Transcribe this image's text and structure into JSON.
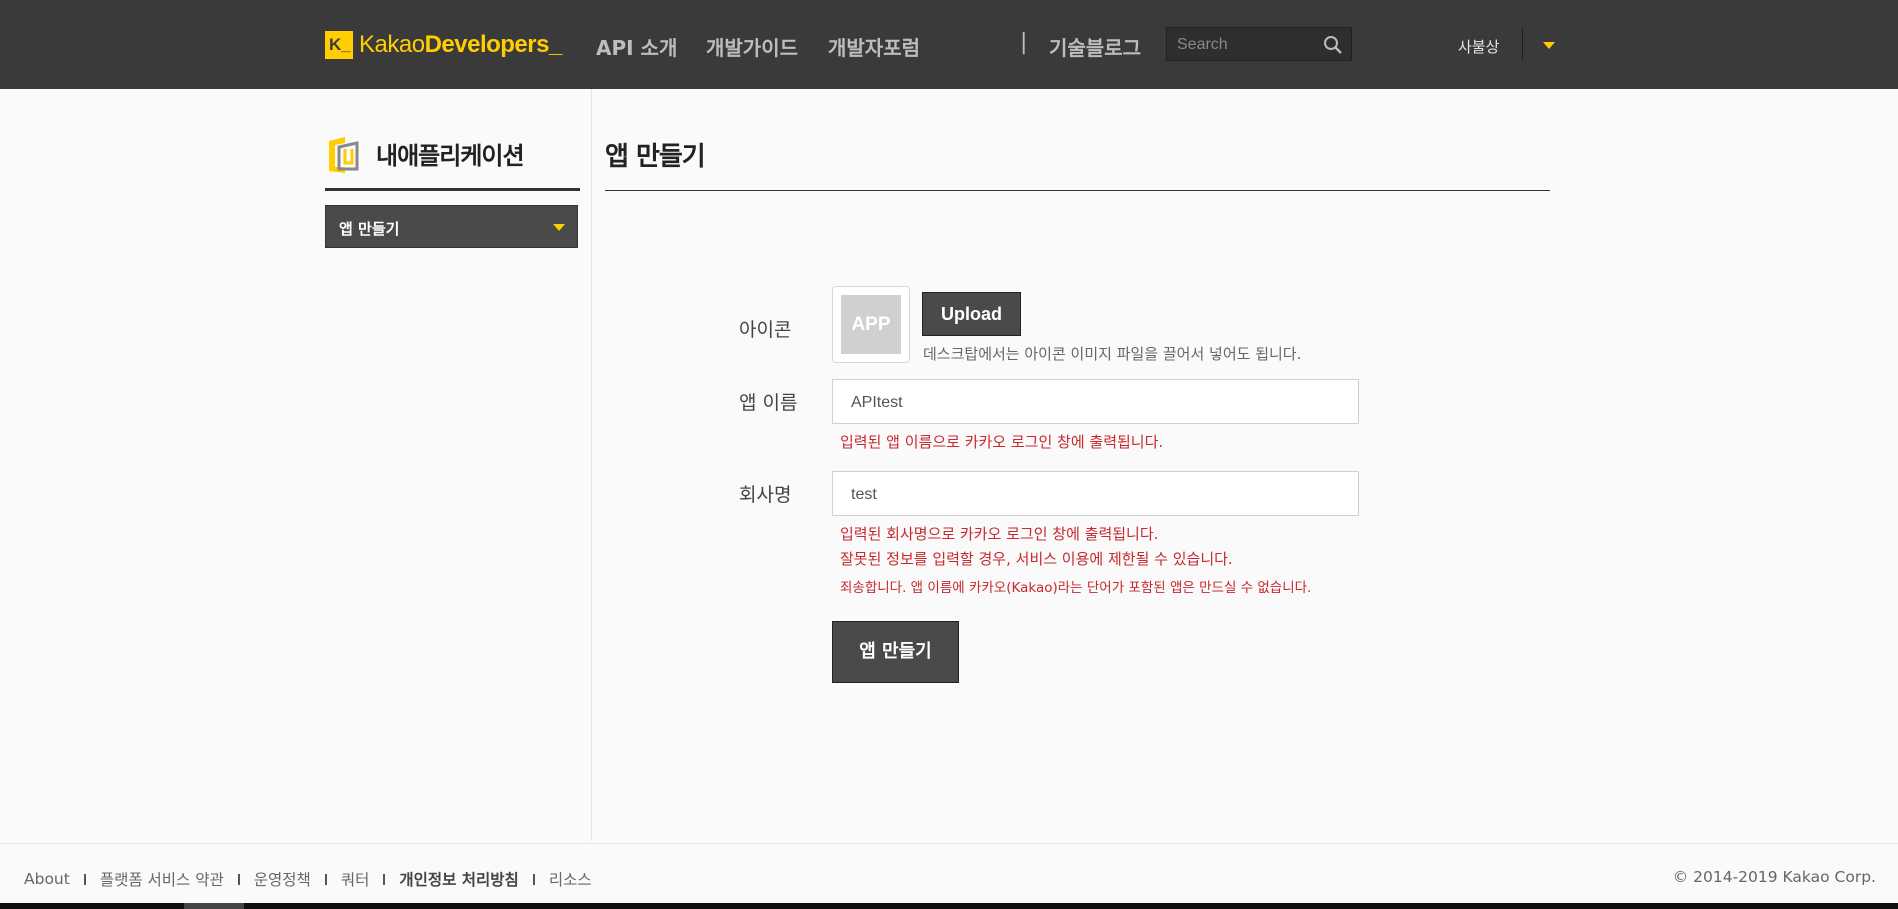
{
  "header": {
    "logo_badge": "K_",
    "logo_text_light": "Kakao",
    "logo_text_bold": "Developers",
    "logo_text_cursor": "_",
    "nav": [
      "API 소개",
      "개발가이드",
      "개발자포럼"
    ],
    "separator": "|",
    "blog": "기술블로그",
    "search_placeholder": "Search",
    "user_name": "사불상"
  },
  "sidebar": {
    "title": "내애플리케이션",
    "selected": "앱 만들기"
  },
  "main": {
    "title": "앱 만들기",
    "icon_label": "아이콘",
    "icon_placeholder": "APP",
    "upload_label": "Upload",
    "icon_hint": "데스크탑에서는 아이콘 이미지 파일을 끌어서 넣어도 됩니다.",
    "app_name_label": "앱 이름",
    "app_name_value": "APItest",
    "app_name_note": "입력된 앱 이름으로 카카오 로그인 창에 출력됩니다.",
    "company_label": "회사명",
    "company_value": "test",
    "company_note_1": "입력된 회사명으로 카카오 로그인 창에 출력됩니다.",
    "company_note_2": "잘못된 정보를 입력할 경우, 서비스 이용에 제한될 수 있습니다.",
    "company_note_3": "죄송합니다. 앱 이름에 카카오(Kakao)라는 단어가 포함된 앱은 만드실 수 없습니다.",
    "create_button": "앱 만들기"
  },
  "footer": {
    "links": [
      "About",
      "플랫폼 서비스 약관",
      "운영정책",
      "쿼터",
      "개인정보 처리방침",
      "리소스"
    ],
    "copyright": "© 2014-2019 Kakao Corp."
  },
  "colors": {
    "header_bg": "#3a3a3a",
    "brand_yellow": "#ffcd00",
    "error_red": "#c8282e",
    "button_dark": "#4a4a4a"
  }
}
